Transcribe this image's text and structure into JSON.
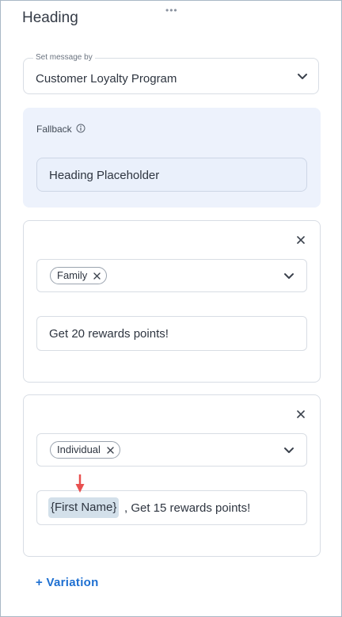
{
  "panel": {
    "drag_handle": "•••",
    "title": "Heading"
  },
  "message_source": {
    "legend": "Set message by",
    "value": "Customer Loyalty Program"
  },
  "fallback": {
    "label": "Fallback",
    "value": "Heading Placeholder"
  },
  "variations": [
    {
      "tag": "Family",
      "message": "Get 20 rewards points!"
    },
    {
      "tag": "Individual",
      "token": "{First Name}",
      "message_after_token": ", Get 15 rewards points!"
    }
  ],
  "add_variation_label": "+ Variation",
  "colors": {
    "accent": "#1d6fd1",
    "fallback_bg": "#edf2fc",
    "token_bg": "#d3e0ea",
    "arrow": "#e8504f"
  }
}
